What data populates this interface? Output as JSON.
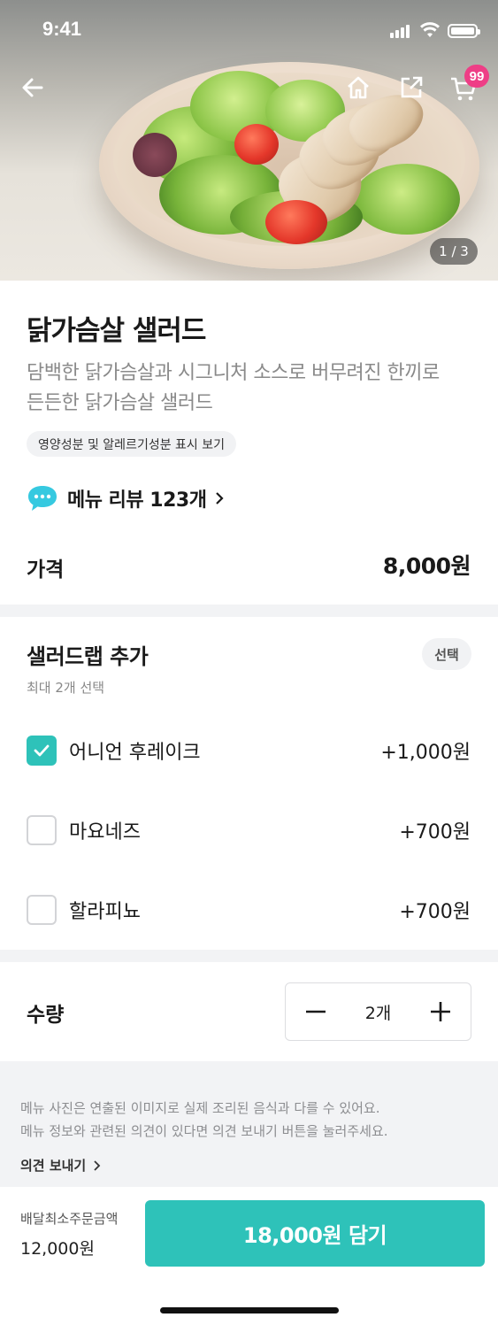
{
  "status_bar": {
    "time": "9:41"
  },
  "header": {
    "cart_count": "99",
    "image_index": "1 / 3"
  },
  "product": {
    "title": "닭가슴살 샐러드",
    "description_line1": "담백한 닭가슴살과 시그니처 소스로 버무려진 한끼로",
    "description_line2": "든든한 닭가슴살 샐러드",
    "nutrition_chip": "영양성분 및 알레르기성분 표시 보기",
    "review_link": "메뉴 리뷰 123개",
    "price_label": "가격",
    "price_value": "8,000원"
  },
  "options": {
    "title": "샐러드랩 추가",
    "subtitle": "최대 2개 선택",
    "select_chip": "선택",
    "items": [
      {
        "name": "어니언 후레이크",
        "price": "+1,000원",
        "checked": true
      },
      {
        "name": "마요네즈",
        "price": "+700원",
        "checked": false
      },
      {
        "name": "할라피뇨",
        "price": "+700원",
        "checked": false
      }
    ]
  },
  "quantity": {
    "label": "수량",
    "value": "2개"
  },
  "notice": {
    "line1": "메뉴 사진은 연출된 이미지로 실제 조리된 음식과 다를 수 있어요.",
    "line2": "메뉴 정보와 관련된 의견이 있다면 의견 보내기 버튼을 눌러주세요.",
    "feedback_link": "의견 보내기"
  },
  "bottom": {
    "min_order_label": "배달최소주문금액",
    "min_order_value": "12,000원",
    "cta_label": "18,000원 담기"
  },
  "colors": {
    "accent": "#2ec2b9",
    "badge": "#ee3e86",
    "divider": "#f2f3f5"
  },
  "icons": [
    "back-arrow-icon",
    "home-icon",
    "share-icon",
    "cart-icon",
    "chat-bubble-icon",
    "chevron-right-icon",
    "checkmark-icon",
    "minus-icon",
    "plus-icon"
  ]
}
